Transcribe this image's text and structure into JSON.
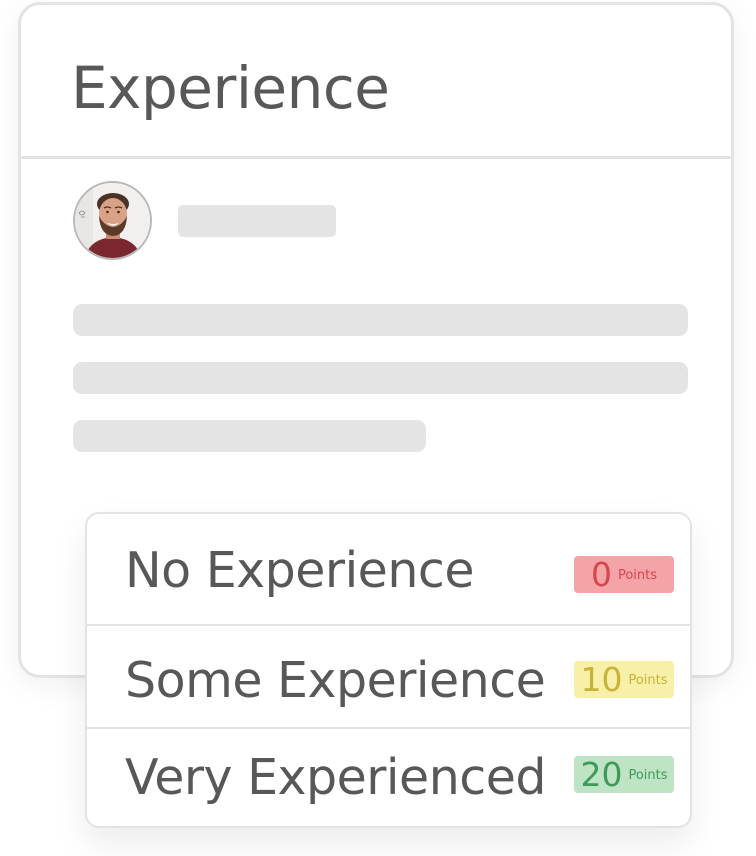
{
  "card": {
    "title": "Experience"
  },
  "profile": {
    "avatar_icon": "profile-photo"
  },
  "options": [
    {
      "label": "No Experience",
      "points": "0",
      "unit": "Points",
      "color": "#f4a3a6",
      "text_color": "#d8454f"
    },
    {
      "label": "Some Experience",
      "points": "10",
      "unit": "Points",
      "color": "#f8efa8",
      "text_color": "#c8b33a"
    },
    {
      "label": "Very Experienced",
      "points": "20",
      "unit": "Points",
      "color": "#bfe3c5",
      "text_color": "#3c9b58"
    }
  ],
  "colors": {
    "border": "#e3e3e3",
    "text": "#585858",
    "skeleton": "#e4e4e4"
  }
}
